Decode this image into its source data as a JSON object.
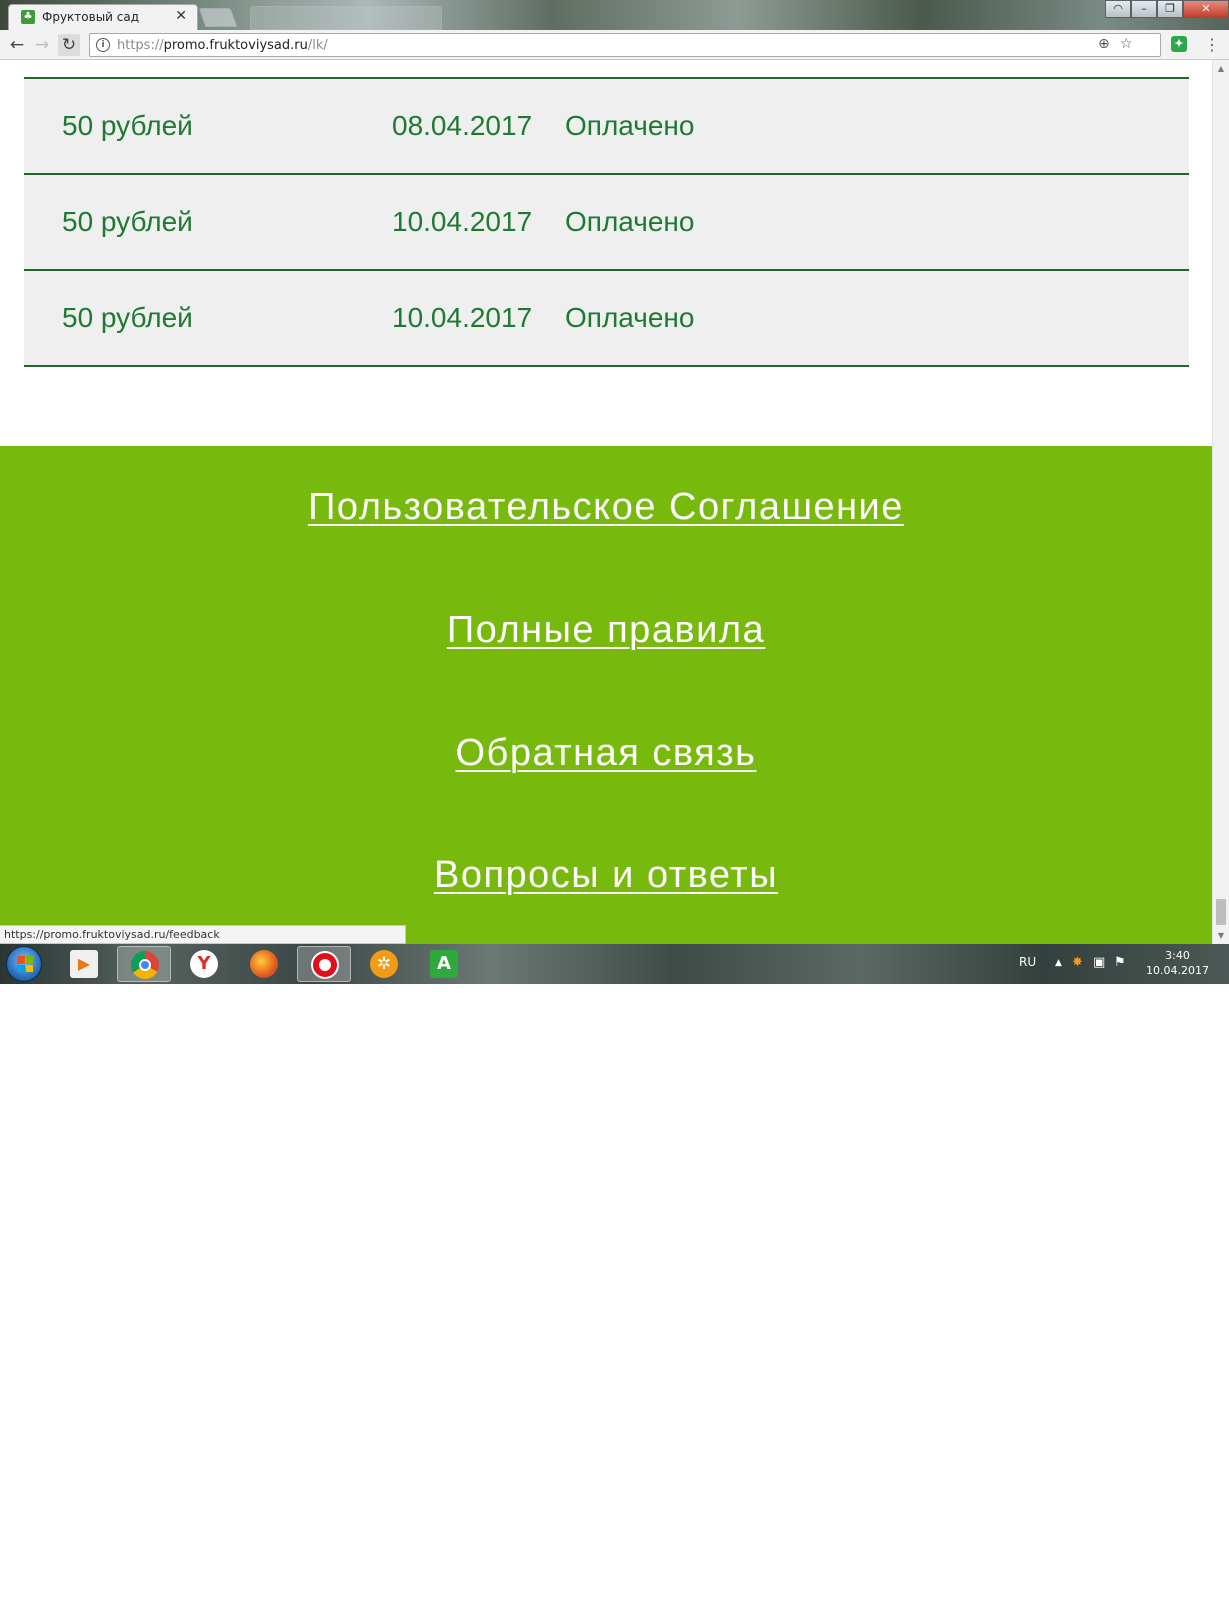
{
  "browser": {
    "tab_title": "Фруктовый сад",
    "tab_close": "✕",
    "url_scheme": "https://",
    "url_host": "promo.fruktoviysad.ru",
    "url_path": "/lk/",
    "status_url": "https://promo.fruktoviysad.ru/feedback",
    "icons": {
      "back": "back-arrow-icon",
      "forward": "forward-arrow-icon",
      "reload": "reload-icon",
      "info": "info-icon",
      "zoom": "zoom-icon",
      "bookmark": "star-icon",
      "extension": "extension-icon",
      "menu": "menu-dots-icon"
    }
  },
  "payments": {
    "rows": [
      {
        "amount": "50 рублей",
        "date": "08.04.2017",
        "status": "Оплачено"
      },
      {
        "amount": "50 рублей",
        "date": "10.04.2017",
        "status": "Оплачено"
      },
      {
        "amount": "50 рублей",
        "date": "10.04.2017",
        "status": "Оплачено"
      }
    ]
  },
  "footer": {
    "links": [
      "Пользовательское Соглашение",
      "Полные правила",
      "Обратная связь",
      "Вопросы и ответы"
    ]
  },
  "taskbar": {
    "language": "RU",
    "time": "3:40",
    "date": "10.04.2017",
    "apps": [
      "media-player-icon",
      "chrome-icon",
      "yandex-browser-icon",
      "firefox-icon",
      "opera-icon",
      "amigo-icon",
      "a-app-icon"
    ]
  },
  "colors": {
    "accent_green": "#78b90e",
    "row_text": "#1e7a33",
    "row_border": "#1e6b2c",
    "row_background": "#efefef"
  }
}
